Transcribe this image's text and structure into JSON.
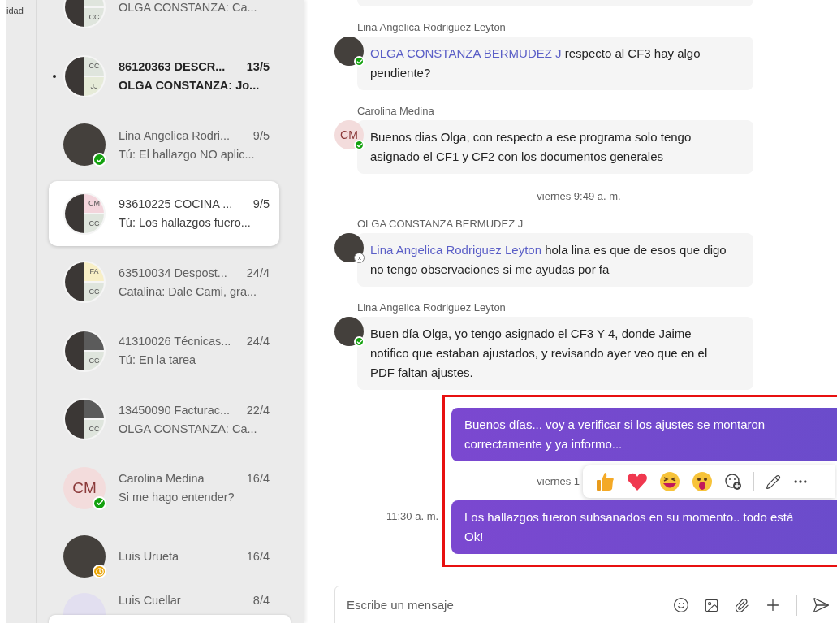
{
  "rail": {
    "label": "idad"
  },
  "chats": [
    {
      "preview": "OLGA CONSTANZA: Ca...",
      "unread": false,
      "selected": false,
      "avatar": {
        "kind": "group",
        "tiles": [
          {
            "kind": "initials",
            "text": "CC",
            "color": "#dfe5dd"
          }
        ]
      }
    },
    {
      "name": "86120363 DESCR...",
      "date": "13/5",
      "preview": "OLGA CONSTANZA: Jo...",
      "unread": true,
      "selected": false,
      "avatar": {
        "kind": "group",
        "tiles": [
          {
            "kind": "initials",
            "text": "CC",
            "color": "#dfe5dd"
          },
          {
            "kind": "initials",
            "text": "JJ",
            "color": "#e6ebd8"
          }
        ]
      }
    },
    {
      "name": "Lina Angelica Rodri...",
      "date": "9/5",
      "preview": "Tú: El hallazgo NO aplic...",
      "unread": false,
      "selected": false,
      "avatar": {
        "kind": "photo",
        "status": {
          "kind": "available"
        }
      }
    },
    {
      "name": "93610225 COCINA ...",
      "date": "9/5",
      "preview": "Tú: Los hallazgos fuero...",
      "unread": false,
      "selected": true,
      "avatar": {
        "kind": "group",
        "tiles": [
          {
            "kind": "initials",
            "text": "CM",
            "color": "#f3d5dc"
          },
          {
            "kind": "initials",
            "text": "CC",
            "color": "#dfe5dd"
          }
        ]
      }
    },
    {
      "name": "63510034 Despost...",
      "date": "24/4",
      "preview": "Catalina: Dale Cami, gra...",
      "unread": false,
      "selected": false,
      "avatar": {
        "kind": "group",
        "tiles": [
          {
            "kind": "initials",
            "text": "FA",
            "color": "#f8efc6"
          },
          {
            "kind": "initials",
            "text": "CC",
            "color": "#dfe5dd"
          }
        ]
      }
    },
    {
      "name": "41310026 Técnicas...",
      "date": "24/4",
      "preview": "Tú: En la tarea",
      "unread": false,
      "selected": false,
      "avatar": {
        "kind": "group",
        "tiles": [
          {
            "kind": "photo"
          },
          {
            "kind": "initials",
            "text": "CC",
            "color": "#dfe5dd"
          }
        ]
      }
    },
    {
      "name": "13450090 Facturac...",
      "date": "22/4",
      "preview": "OLGA CONSTANZA: Ca...",
      "unread": false,
      "selected": false,
      "avatar": {
        "kind": "group",
        "tiles": [
          {
            "kind": "photo"
          },
          {
            "kind": "initials",
            "text": "CC",
            "color": "#dfe5dd"
          }
        ]
      }
    },
    {
      "name": "Carolina Medina",
      "date": "16/4",
      "preview": "Si me hago entender?",
      "unread": false,
      "selected": false,
      "avatar": {
        "kind": "initials",
        "text": "CM",
        "status": {
          "kind": "available"
        }
      }
    },
    {
      "name": "Luis Urueta",
      "date": "16/4",
      "unread": false,
      "selected": false,
      "avatar": {
        "kind": "photo",
        "status": {
          "kind": "away"
        }
      }
    },
    {
      "name": "Luis Cuellar",
      "date": "8/4",
      "unread": false,
      "selected": false,
      "avatar": {
        "kind": "blank"
      }
    }
  ],
  "messages": [
    {
      "kind": "incoming",
      "sender": "Lina Angelica Rodriguez Leyton",
      "avatar": {
        "kind": "photo",
        "status": {
          "kind": "available"
        }
      },
      "mention": "OLGA CONSTANZA BERMUDEZ J",
      "text": "respecto al CF3 hay algo pendiente?"
    },
    {
      "kind": "incoming",
      "sender": "Carolina Medina",
      "avatar": {
        "kind": "initials",
        "text": "CM",
        "status": {
          "kind": "available"
        }
      },
      "text": "Buenos dias Olga, con respecto a ese programa solo tengo asignado el CF1 y CF2 con los documentos generales"
    },
    {
      "kind": "divider",
      "text": "viernes 9:49 a. m."
    },
    {
      "kind": "incoming",
      "sender": "OLGA CONSTANZA BERMUDEZ J",
      "avatar": {
        "kind": "photo",
        "status": {
          "kind": "offline"
        }
      },
      "mention": "Lina Angelica Rodriguez Leyton",
      "text": "hola lina es que de esos que digo no tengo observaciones si me ayudas por fa"
    },
    {
      "kind": "incoming",
      "sender": "Lina Angelica Rodriguez Leyton",
      "avatar": {
        "kind": "photo",
        "status": {
          "kind": "available"
        }
      },
      "text": "Buen día Olga, yo tengo asignado el CF3 Y 4, donde Jaime notifico que estaban ajustados, y revisando ayer veo que en el PDF  faltan ajustes."
    },
    {
      "kind": "outgoing",
      "text": "Buenos días... voy a verificar si los ajustes se montaron correctamente y ya informo..."
    },
    {
      "kind": "reaction-divider",
      "text": "viernes 1"
    },
    {
      "kind": "outgoing",
      "time": "11:30 a. m.",
      "text": "Los hallazgos fueron subsanados en su momento.. todo está Ok!"
    }
  ],
  "compose": {
    "placeholder": "Escribe un mensaje"
  }
}
